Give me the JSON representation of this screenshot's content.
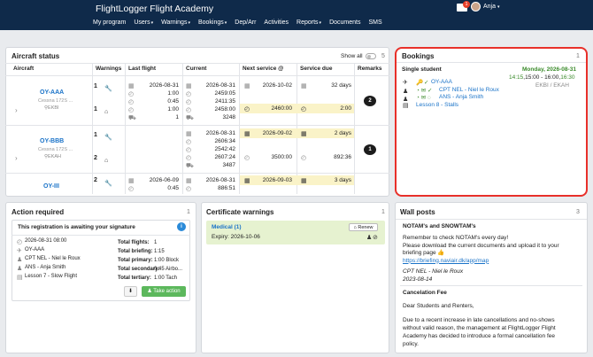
{
  "header": {
    "brand": "FlightLogger Flight Academy",
    "nav": [
      "My program",
      "Users",
      "Warnings",
      "Bookings",
      "Dep/Arr",
      "Activities",
      "Reports",
      "Documents",
      "SMS"
    ],
    "mail_badge": "1",
    "user": "Anja"
  },
  "aircraft_status": {
    "title": "Aircraft status",
    "show_all": "Show all",
    "count": "5",
    "columns": [
      "Aircraft",
      "Warnings",
      "Last flight",
      "Current",
      "Next service @",
      "Service due",
      "Remarks"
    ],
    "aircraft": [
      {
        "reg": "OY-AAA",
        "model": "Cessna 172S ...",
        "base": "EKBI",
        "warnings": [
          "1",
          "1"
        ],
        "last_flight": [
          "2026-08-31",
          "1:00",
          "0:45",
          "1:00",
          "1"
        ],
        "current": [
          "2026-08-31",
          "2459:05",
          "2411:35",
          "2458:00",
          "3248"
        ],
        "next_service": [
          "2026-10-02",
          "2460:00"
        ],
        "service_due": [
          "32 days",
          "2:00"
        ],
        "remarks": "2"
      },
      {
        "reg": "OY-BBB",
        "model": "Cessna 172S ...",
        "base": "EKAH",
        "warnings": [
          "1",
          "2"
        ],
        "last_flight": [],
        "current": [
          "2026-08-31",
          "2606:34",
          "2542:42",
          "2607:24",
          "3487"
        ],
        "next_service": [
          "2026-09-02",
          "3500:00"
        ],
        "service_due": [
          "2 days",
          "892:36"
        ],
        "remarks": "1"
      },
      {
        "reg": "OY-III",
        "model": "",
        "base": "",
        "warnings": [
          "2"
        ],
        "last_flight": [
          "2026-06-09",
          "0:45"
        ],
        "current": [
          "2026-08-31",
          "886:51"
        ],
        "next_service": [
          "2026-09-03"
        ],
        "service_due": [
          "3 days"
        ],
        "remarks": ""
      }
    ]
  },
  "bookings": {
    "title": "Bookings",
    "count": "1",
    "type": "Single student",
    "date": "Monday, 2026-08-31",
    "time_start": "14:15",
    "time_mid": ",15:00 - 16:00,",
    "time_end": "16:30",
    "route": "EKBI / EKAH",
    "aircraft": "OY-AAA",
    "instructor": "CPT NEL - Niel le Roux",
    "student": "ANS - Anja Smith",
    "lesson": "Lesson 8 - Stalls"
  },
  "action_required": {
    "title": "Action required",
    "count": "1",
    "heading": "This registration is awaiting your signature",
    "left": [
      "2026-08-31 08:00",
      "OY-AAA",
      "CPT NEL - Niel le Roux",
      "ANS - Anja Smith",
      "Lesson 7 - Slow Flight"
    ],
    "right_labels": [
      "Total flights:",
      "Total briefing:",
      "Total primary:",
      "Total secondary:",
      "Total tertiary:"
    ],
    "right_values": [
      "1",
      "1:15",
      "1:00 Block",
      "0:45 Airbo...",
      "1:00 Tach"
    ],
    "action_label": "Take action"
  },
  "certificate_warnings": {
    "title": "Certificate warnings",
    "count": "1",
    "item": "Medical (1)",
    "renew": "Renew",
    "expiry": "Expiry: 2026-10-06"
  },
  "wall_posts": {
    "title": "Wall posts",
    "count": "3",
    "post1_title": "NOTAM's and SNOWTAM's",
    "post1_line1": "Remember to check NOTAM's every day!",
    "post1_line2": "Please download the current documents and upload it to your",
    "post1_line3": "briefing page 👍",
    "post1_link": "https://briefing.naviair.dk/app/map",
    "post1_author": "CPT NEL - Niel le Roux",
    "post1_date": "2023-08-14",
    "post2_title": "Cancelation Fee",
    "post2_greeting": "Dear Students and Renters,",
    "post2_l1": "Due to a recent increase in late cancellations and no-shows",
    "post2_l2": "without valid reason, the management at FlightLogger Flight",
    "post2_l3": "Academy has decided to introduce a formal cancellation fee",
    "post2_l4": "policy."
  },
  "colors": {
    "topbar": "#0f2a4a",
    "link": "#1a73c8",
    "highlight": "#e8302a",
    "green": "#3a8a2a",
    "cert_bg": "#e6f2d0"
  }
}
